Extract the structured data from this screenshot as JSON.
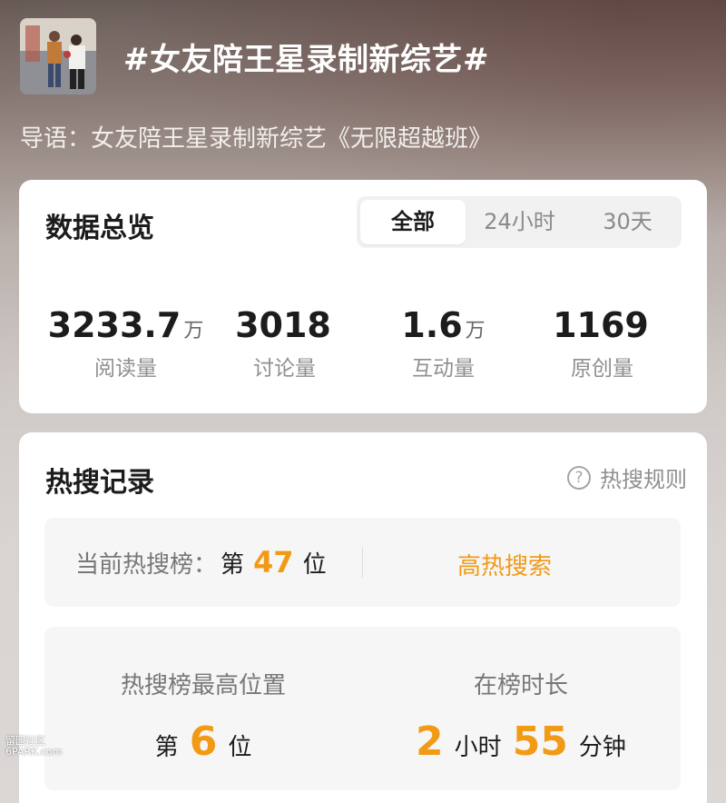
{
  "header": {
    "title": "#女友陪王星录制新综艺#",
    "intro": "导语：女友陪王星录制新综艺《无限超越班》"
  },
  "overview": {
    "title": "数据总览",
    "tabs": [
      {
        "label": "全部",
        "active": true
      },
      {
        "label": "24小时",
        "active": false
      },
      {
        "label": "30天",
        "active": false
      }
    ],
    "stats": [
      {
        "value": "3233.7",
        "unit": "万",
        "label": "阅读量"
      },
      {
        "value": "3018",
        "unit": "",
        "label": "讨论量"
      },
      {
        "value": "1.6",
        "unit": "万",
        "label": "互动量"
      },
      {
        "value": "1169",
        "unit": "",
        "label": "原创量"
      }
    ]
  },
  "hot_search": {
    "title": "热搜记录",
    "rules_label": "热搜规则",
    "current_label": "当前热搜榜：",
    "rank_prefix": "第",
    "current_rank": "47",
    "rank_suffix": "位",
    "hot_link": "高热搜索",
    "peak_label": "热搜榜最高位置",
    "peak_prefix": "第",
    "peak_rank": "6",
    "peak_suffix": "位",
    "duration_label": "在榜时长",
    "duration_hours": "2",
    "hours_unit": "小时",
    "duration_minutes": "55",
    "minutes_unit": "分钟"
  },
  "watermark": {
    "line1": "留园社区",
    "line2": "6PARK.com"
  },
  "colors": {
    "accent": "#f19a15",
    "card_bg": "#ffffff",
    "muted_text": "#8f8f8f"
  }
}
